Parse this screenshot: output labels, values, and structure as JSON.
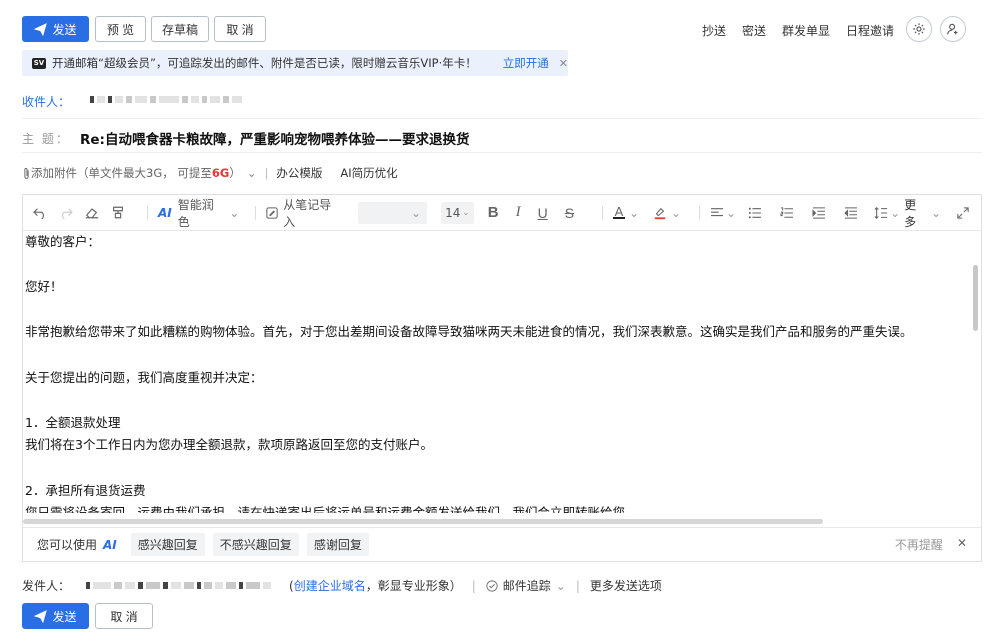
{
  "toolbar_top": {
    "send": "发送",
    "preview": "预 览",
    "save_draft": "存草稿",
    "cancel": "取 消"
  },
  "top_links": [
    "抄送",
    "密送",
    "群发单显",
    "日程邀请"
  ],
  "banner": {
    "text": "开通邮箱“超级会员”，可追踪发出的邮件、附件是否已读，限时赠云音乐VIP·年卡！",
    "link": "立即开通"
  },
  "recipient": {
    "label": "收件人："
  },
  "subject": {
    "label": "主 题：",
    "value": "Re:自动喂食器卡粮故障，严重影响宠物喂养体验——要求退换货"
  },
  "attachments": {
    "add": "添加附件",
    "hint_prefix": "（单文件最大3G，  可提至",
    "hint_size": "6G",
    "hint_suffix": " ）",
    "tools": [
      "办公模版",
      "AI简历优化"
    ]
  },
  "editor_toolbar": {
    "ai_polish": "智能润色",
    "import_note": "从笔记导入",
    "font_size": "14",
    "more": "更多"
  },
  "body_lines": [
    "尊敬的客户：",
    "",
    "您好！",
    "",
    "非常抱歉给您带来了如此糟糕的购物体验。首先，对于您出差期间设备故障导致猫咪两天未能进食的情况，我们深表歉意。这确实是我们产品和服务的严重失误。",
    "",
    "关于您提出的问题，我们高度重视并决定：",
    "",
    "1．全额退款处理",
    "我们将在3个工作日内为您办理全额退款，款项原路返回至您的支付账户。",
    "",
    "2．承担所有退货运费",
    "您只需将设备寄回，运费由我们承担。请在快递寄出后将运单号和运费金额发送给我们，我们会立即转账给您"
  ],
  "quick_reply": {
    "prefix": "您可以使用",
    "ai": "AI",
    "chips": [
      "感兴趣回复",
      "不感兴趣回复",
      "感谢回复"
    ],
    "dismiss": "不再提醒"
  },
  "sender": {
    "label": "发件人：",
    "create_domain": "创建企业域名",
    "create_domain_suffix": "，彰显专业形象）",
    "tracking": "邮件追踪",
    "more_options": "更多发送选项"
  },
  "bottom": {
    "send": "发送",
    "cancel": "取 消"
  }
}
